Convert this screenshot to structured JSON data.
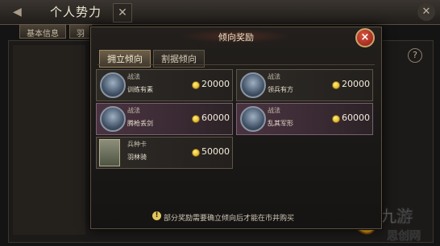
{
  "background": {
    "title": "个人势力",
    "tabs": [
      "基本信息",
      "羽"
    ],
    "help": "?"
  },
  "modal": {
    "title": "倾向奖励",
    "close": "×",
    "tabs": [
      {
        "label": "拥立倾向",
        "active": true
      },
      {
        "label": "割据倾向",
        "active": false
      }
    ],
    "cards": [
      {
        "type": "战法",
        "name": "训练有素",
        "cost": "20000",
        "style": "dark",
        "icon": "general-portrait-icon"
      },
      {
        "type": "战法",
        "name": "领兵有方",
        "cost": "20000",
        "style": "dark",
        "icon": "general-portrait-icon"
      },
      {
        "type": "战法",
        "name": "腾枪丢剑",
        "cost": "60000",
        "style": "purple",
        "icon": "general-portrait-icon"
      },
      {
        "type": "战法",
        "name": "乱其军形",
        "cost": "60000",
        "style": "purple",
        "icon": "general-portrait-icon"
      },
      {
        "type": "兵种卡",
        "name": "羽林骑",
        "cost": "50000",
        "style": "dark",
        "icon": "troop-card-icon"
      }
    ],
    "note": "部分奖励需要确立倾向后才能在市井购买"
  },
  "watermark": {
    "line1": "九游",
    "line2": "思创网"
  },
  "colors": {
    "gold": "#d49a12",
    "purple_card": "#4a3340",
    "close_red": "#c23b2c"
  }
}
